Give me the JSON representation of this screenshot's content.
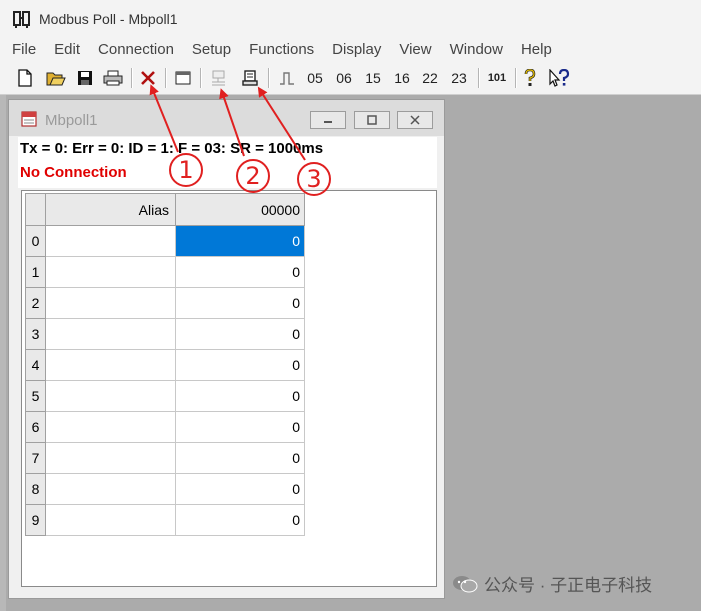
{
  "app": {
    "title": "Modbus Poll - Mbpoll1"
  },
  "menu": [
    "File",
    "Edit",
    "Connection",
    "Setup",
    "Functions",
    "Display",
    "View",
    "Window",
    "Help"
  ],
  "toolbar": {
    "fn05": "05",
    "fn06": "06",
    "fn15": "15",
    "fn16": "16",
    "fn22": "22",
    "fn23": "23",
    "fn101": "101",
    "help_glyph": "?"
  },
  "child": {
    "title": "Mbpoll1",
    "status": "Tx = 0: Err = 0: ID = 1: F = 03: SR = 1000ms",
    "connection": "No Connection",
    "grid": {
      "header": {
        "alias": "Alias",
        "register": "00000"
      },
      "rows": [
        {
          "index": "0",
          "alias": "",
          "value": "0"
        },
        {
          "index": "1",
          "alias": "",
          "value": "0"
        },
        {
          "index": "2",
          "alias": "",
          "value": "0"
        },
        {
          "index": "3",
          "alias": "",
          "value": "0"
        },
        {
          "index": "4",
          "alias": "",
          "value": "0"
        },
        {
          "index": "5",
          "alias": "",
          "value": "0"
        },
        {
          "index": "6",
          "alias": "",
          "value": "0"
        },
        {
          "index": "7",
          "alias": "",
          "value": "0"
        },
        {
          "index": "8",
          "alias": "",
          "value": "0"
        },
        {
          "index": "9",
          "alias": "",
          "value": "0"
        }
      ]
    }
  },
  "annotations": {
    "one": "1",
    "two": "2",
    "three": "3"
  },
  "watermark": "公众号 · 子正电子科技",
  "colors": {
    "annotation": "#e02020",
    "no_connection": "#e00000",
    "selection": "#0078d7"
  },
  "icons": [
    "app-icon",
    "new-icon",
    "open-icon",
    "save-icon",
    "print-icon",
    "disconnect-icon",
    "window-icon",
    "connect-icon",
    "read-write-icon",
    "pulse-icon",
    "help-icon",
    "context-help-icon"
  ]
}
